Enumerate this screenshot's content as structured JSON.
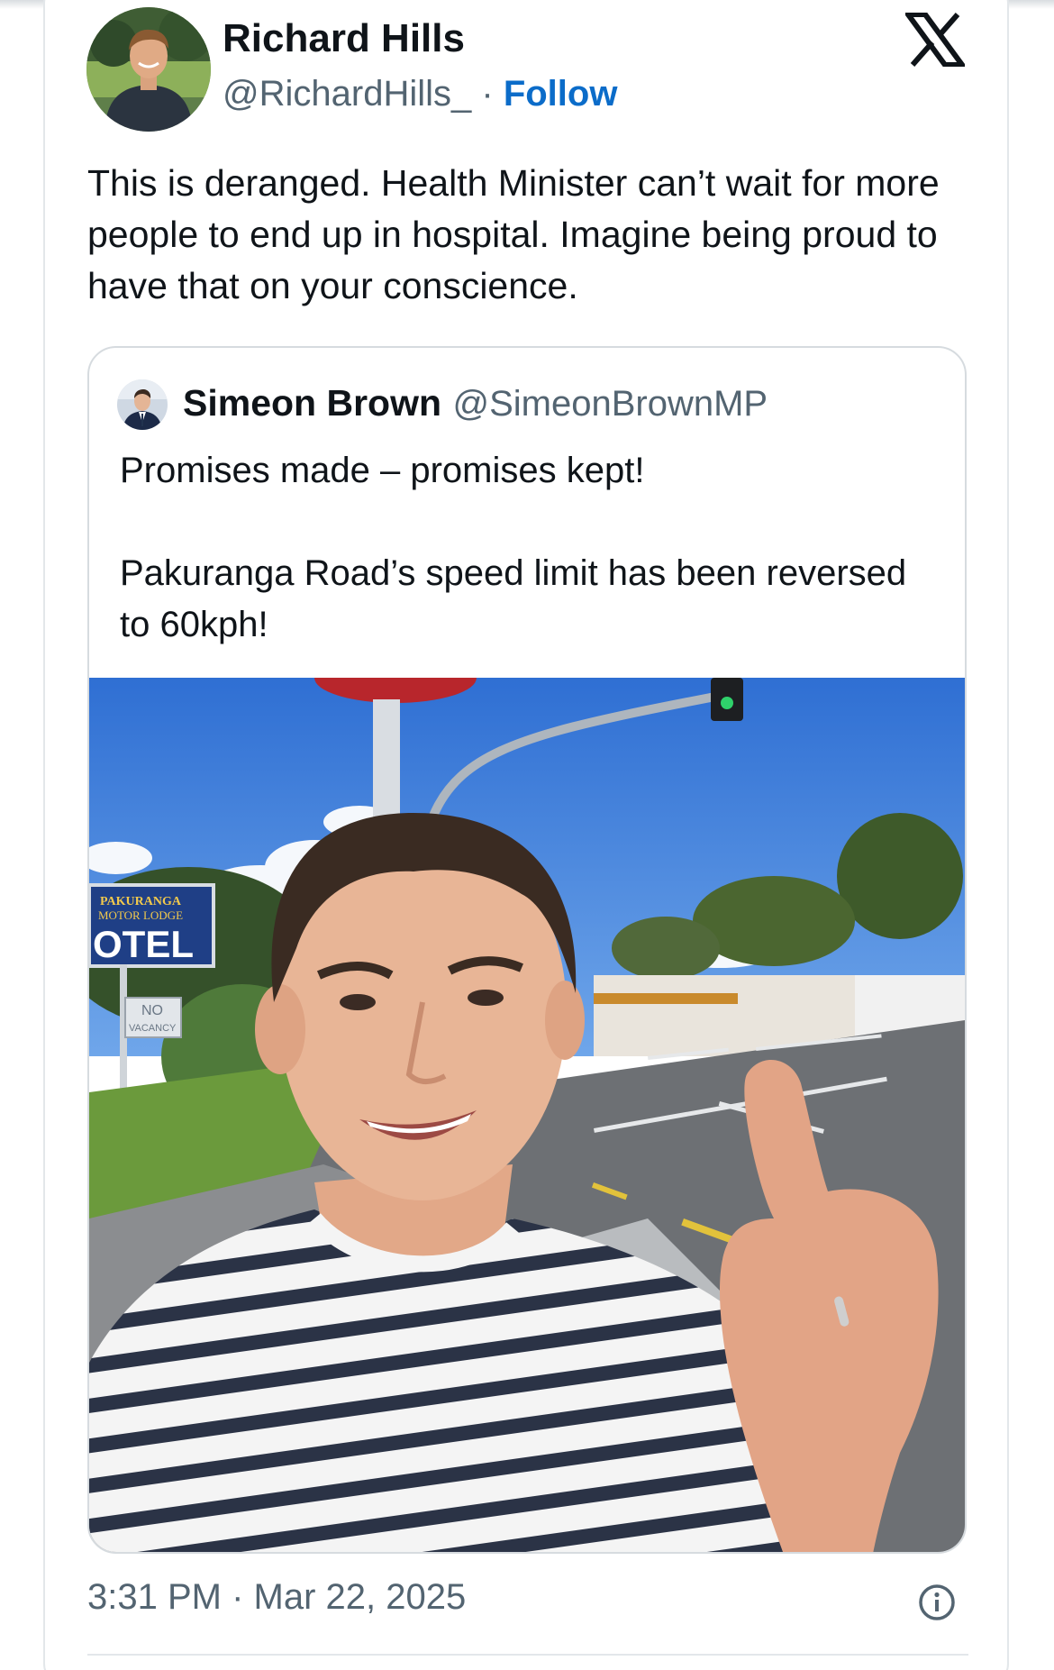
{
  "tweet": {
    "author_name": "Richard Hills",
    "author_handle": "@RichardHills_",
    "separator": "·",
    "follow_label": "Follow",
    "text": "This is deranged. Health Minister can’t wait for more people to end up in hospital. Imagine being proud to have that on your conscience.",
    "timestamp": "3:31 PM · Mar 22, 2025",
    "icons": [
      "x-logo-icon",
      "info-icon"
    ]
  },
  "quoted_tweet": {
    "author_name": "Simeon Brown",
    "author_handle": "@SimeonBrownMP",
    "text_line_1": "Promises made – promises kept!",
    "text_line_2": "Pakuranga Road’s speed limit has been reversed to 60kph!",
    "photo_sign": {
      "line1": "PAKURANGA",
      "line2": "MOTOR LODGE",
      "line3": "OTEL",
      "vacancy_line1": "NO",
      "vacancy_line2": "VACANCY"
    }
  },
  "colors": {
    "accent": "#0b6cc9",
    "secondary_text": "#536471",
    "primary_text": "#0f1419",
    "border": "#e3e7ea"
  }
}
